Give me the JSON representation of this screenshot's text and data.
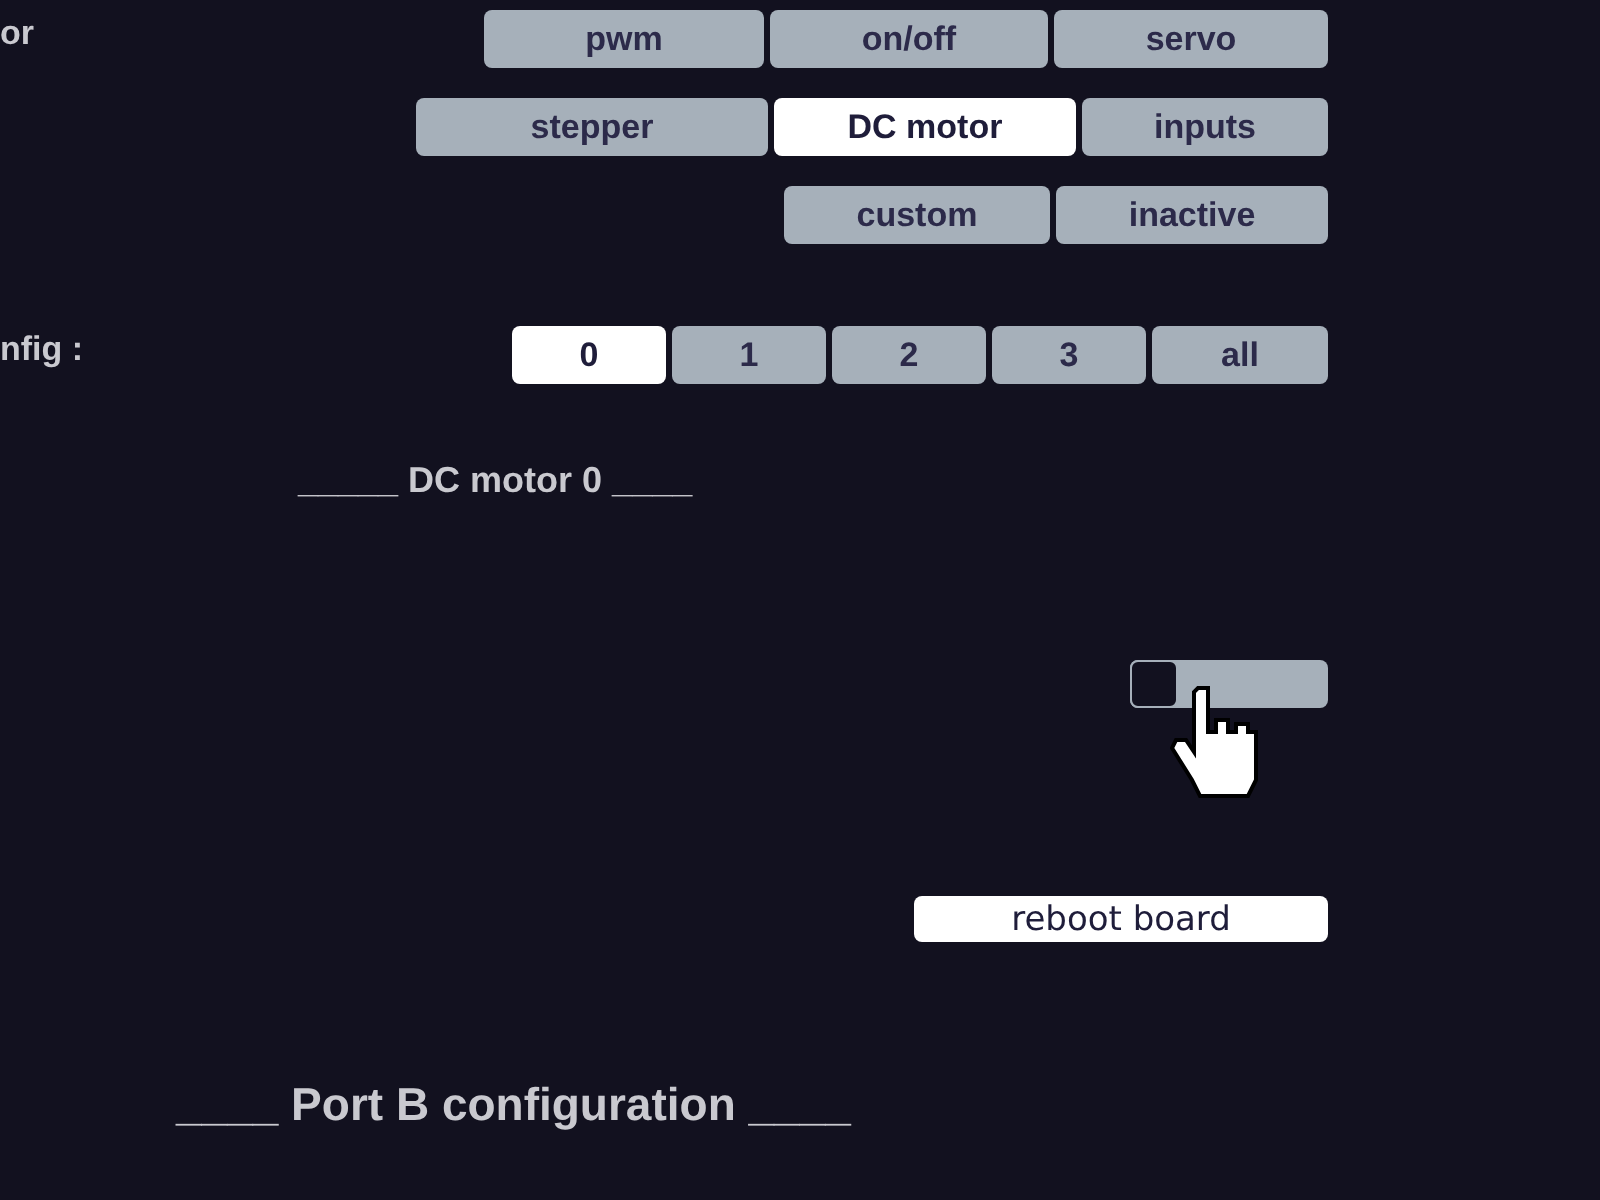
{
  "rows": [
    {
      "label": "or",
      "buttons": [
        {
          "label": "pwm",
          "selected": false
        },
        {
          "label": "on/off",
          "selected": false
        },
        {
          "label": "servo",
          "selected": false
        }
      ]
    },
    {
      "buttons": [
        {
          "label": "stepper",
          "selected": false
        },
        {
          "label": "DC motor",
          "selected": true
        },
        {
          "label": "inputs",
          "selected": false
        }
      ]
    },
    {
      "buttons": [
        {
          "label": "custom",
          "selected": false
        },
        {
          "label": "inactive",
          "selected": false
        }
      ]
    },
    {
      "label": "nfig :",
      "buttons": [
        {
          "label": "0",
          "selected": true
        },
        {
          "label": "1",
          "selected": false
        },
        {
          "label": "2",
          "selected": false
        },
        {
          "label": "3",
          "selected": false
        },
        {
          "label": "all",
          "selected": false
        }
      ]
    }
  ],
  "section_title": "_____ DC motor 0 ____",
  "slider": {
    "level": 0
  },
  "reboot_button": "reboot board",
  "port_b_title": "____ Port B configuration ____"
}
